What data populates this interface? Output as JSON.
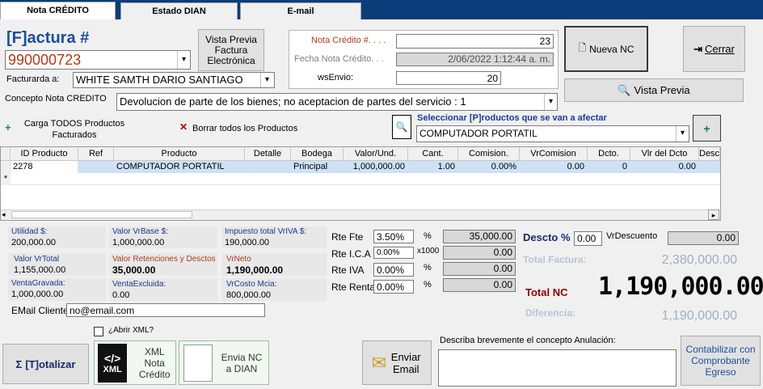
{
  "tabs": [
    "Nota CRÉDITO",
    "Estado DIAN",
    "E-mail"
  ],
  "factura": {
    "label": "[F]actura #",
    "number": "990000723",
    "vista_previa": "Vista Previa Factura Electrónica",
    "facturada_label": "Facturarda a:",
    "facturada_value": "WHITE SAMTH DARIO SANTIAGO",
    "concepto_label": "Concepto Nota CREDITO",
    "concepto_value": "Devolucion de parte de los bienes; no aceptacion de partes del servicio : 1"
  },
  "nc": {
    "num_label": "Nota Crédito #. . . .",
    "num_value": "23",
    "fecha_label": "Fecha Nota Crédito. . .",
    "fecha_value": "2/06/2022 1:12:44 a. m.",
    "ws_label": "wsEnvio:",
    "ws_value": "20"
  },
  "buttons": {
    "nueva_nc": "Nueva NC",
    "cerrar": "Cerrar",
    "vista_previa": "Vista Previa",
    "carga_todos": "Carga TODOS Productos Facturados",
    "borrar_todos": "Borrar todos los Productos",
    "totalizar": "[T]otalizar",
    "xml": "XML Nota Crédito",
    "envia_nc": "Envia NC a DIAN",
    "enviar_email": "Enviar Email",
    "contabilizar": "Contabilizar con Comprobante Egreso"
  },
  "productos": {
    "label": "Seleccionar [P]roductos que se van a afectar",
    "value": "COMPUTADOR PORTATIL"
  },
  "table": {
    "headers": [
      "ID Producto",
      "Ref",
      "Producto",
      "Detalle",
      "Bodega",
      "Valor/Und.",
      "Cant.",
      "Comision.",
      "VrComision",
      "Dcto.",
      "Vlr del Dcto",
      "Desc"
    ],
    "row": [
      "2278",
      "",
      "COMPUTADOR PORTATIL",
      "",
      "Principal",
      "1,000,000.00",
      "1.00",
      "0.00%",
      "0.00",
      "0",
      "0.00",
      ""
    ]
  },
  "summary": {
    "utilidad_label": "Utilidad $:",
    "utilidad": "200,000.00",
    "vrbase_label": "Valor VrBase $:",
    "vrbase": "1,000,000.00",
    "iva_label": "Impuesto total VrIVA $:",
    "iva": "190,000.00",
    "vrtotal_label": "Valor VrTotal",
    "vrtotal": "1,155,000.00",
    "retenciones_label": "Valor Retenciones y Desctos",
    "retenciones": "35,000.00",
    "vrneto_label": "VrNeto",
    "vrneto": "1,190,000.00",
    "gravada_label": "VentaGravada:",
    "gravada": "1,000,000.00",
    "excluida_label": "VentaExcluida:",
    "excluida": "0.00",
    "costo_label": "VrCosto Mcia:",
    "costo": "800,000.00"
  },
  "rte": {
    "fte_label": "Rte Fte",
    "fte_pct": "3.50%",
    "fte_val": "35,000.00",
    "ica_label": "Rte I.C.A",
    "ica_pct": "0.00%",
    "ica_unit": "x1000",
    "ica_val": "0.00",
    "iva_label": "Rte IVA",
    "iva_pct": "0.00%",
    "iva_val": "0.00",
    "renta_label": "Rte Renta",
    "renta_pct": "0.00%",
    "renta_val": "0.00",
    "pct_symbol": "%"
  },
  "totals": {
    "descto_label": "Descto %",
    "descto_value": "0.00",
    "vrdescuento_label": "VrDescuento",
    "vrdescuento": "0.00",
    "total_factura_label": "Total Factura:",
    "total_factura": "2,380,000.00",
    "total_nc_label": "Total NC",
    "total_nc": "1,190,000.00",
    "diferencia_label": "Diferencia:",
    "diferencia": "1,190,000.00"
  },
  "email": {
    "label": "EMail Cliente:",
    "value": "no@email.com"
  },
  "abrir_xml": "¿Abrir XML?",
  "concepto_anulacion_label": "Describa brevemente el concepto Anulación:",
  "colors": {
    "accent": "#0b3d7a",
    "selected_row": "#cde1f7",
    "total_nc": "#8b0000"
  },
  "xml_badge": "XML"
}
